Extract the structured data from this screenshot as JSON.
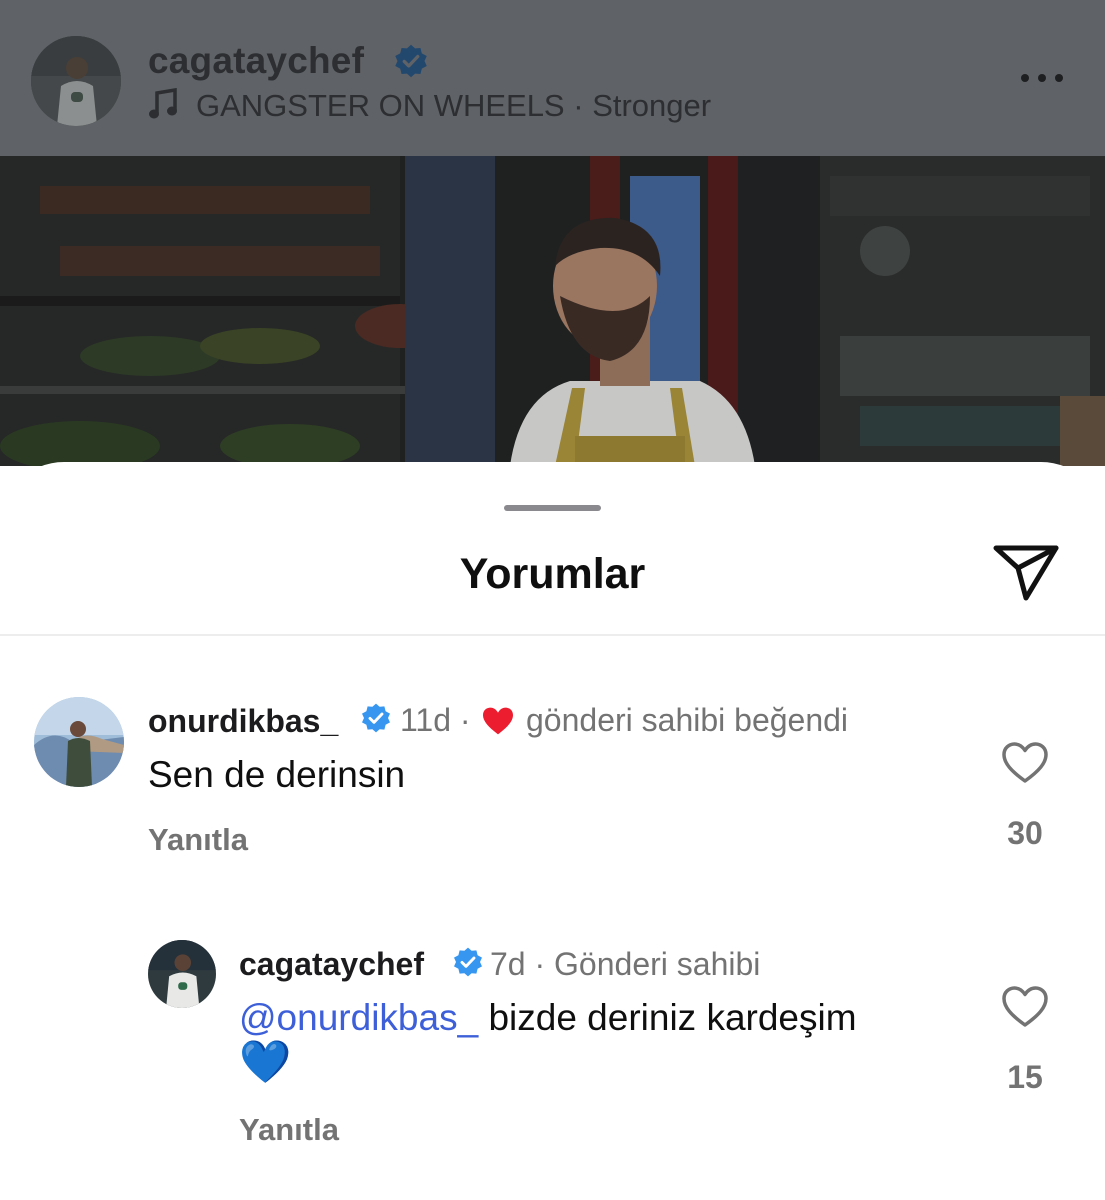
{
  "post": {
    "username": "cagataychef",
    "music_title": "GANGSTER ON WHEELS",
    "music_separator": "·",
    "music_track": "Stronger",
    "more_icon": "more-horizontal-icon"
  },
  "sheet": {
    "title": "Yorumlar",
    "share_icon": "paper-plane-icon"
  },
  "comments": [
    {
      "username": "onurdikbas_",
      "verified": true,
      "time": "11d",
      "separator": "·",
      "liked_by_owner_label": "gönderi sahibi beğendi",
      "text": "Sen de derinsin",
      "reply_label": "Yanıtla",
      "like_count": "30"
    }
  ],
  "replies": [
    {
      "username": "cagataychef",
      "verified": true,
      "time": "7d",
      "separator": "·",
      "owner_label": "Gönderi sahibi",
      "mention": "@onurdikbas_",
      "text": "bizde deriniz kardeşim",
      "emoji": "💙",
      "reply_label": "Yanıtla",
      "like_count": "15"
    }
  ],
  "colors": {
    "verified_blue": "#3797f0",
    "mention_blue": "#3d5fd8",
    "heart_red": "#ed1d30",
    "muted_text": "#737373"
  }
}
